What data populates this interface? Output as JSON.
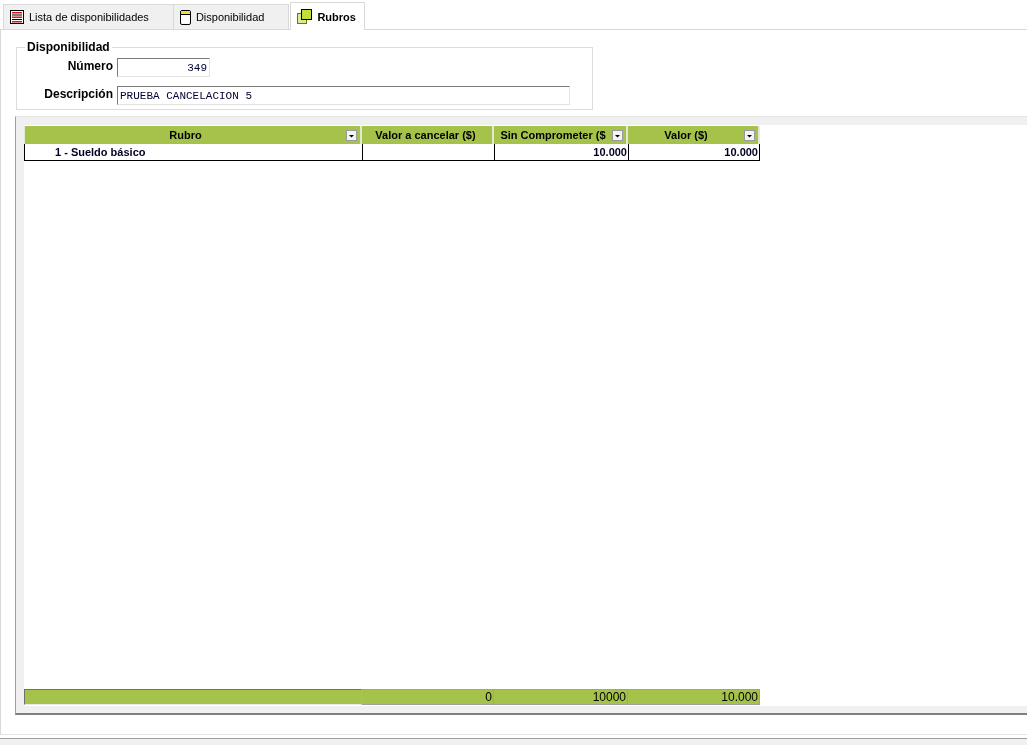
{
  "tabs": [
    {
      "label": "Lista de disponibilidades",
      "selected": false
    },
    {
      "label": "Disponibilidad",
      "selected": false
    },
    {
      "label": "Rubros",
      "selected": true
    }
  ],
  "group": {
    "title": "Disponibilidad",
    "fields": [
      {
        "label": "Número",
        "value": "349",
        "kind": "number"
      },
      {
        "label": "Descripción",
        "value": "PRUEBA CANCELACION 5",
        "kind": "text"
      }
    ]
  },
  "grid": {
    "columns": [
      {
        "label": "Rubro",
        "kind": "text",
        "filter": true
      },
      {
        "label": "Valor a cancelar ($)",
        "kind": "amount",
        "filter": false
      },
      {
        "label": "Sin Comprometer ($",
        "kind": "amount",
        "filter": true
      },
      {
        "label": "Valor ($)",
        "kind": "amount",
        "filter": true
      }
    ],
    "rows": [
      {
        "rubro": "1 - Sueldo básico",
        "sin_comprometer": "10.000",
        "valor": "10.000"
      }
    ],
    "totals": {
      "valor_a_cancelar": "0",
      "sin_comprometer": "10000",
      "valor": "10.000"
    }
  }
}
